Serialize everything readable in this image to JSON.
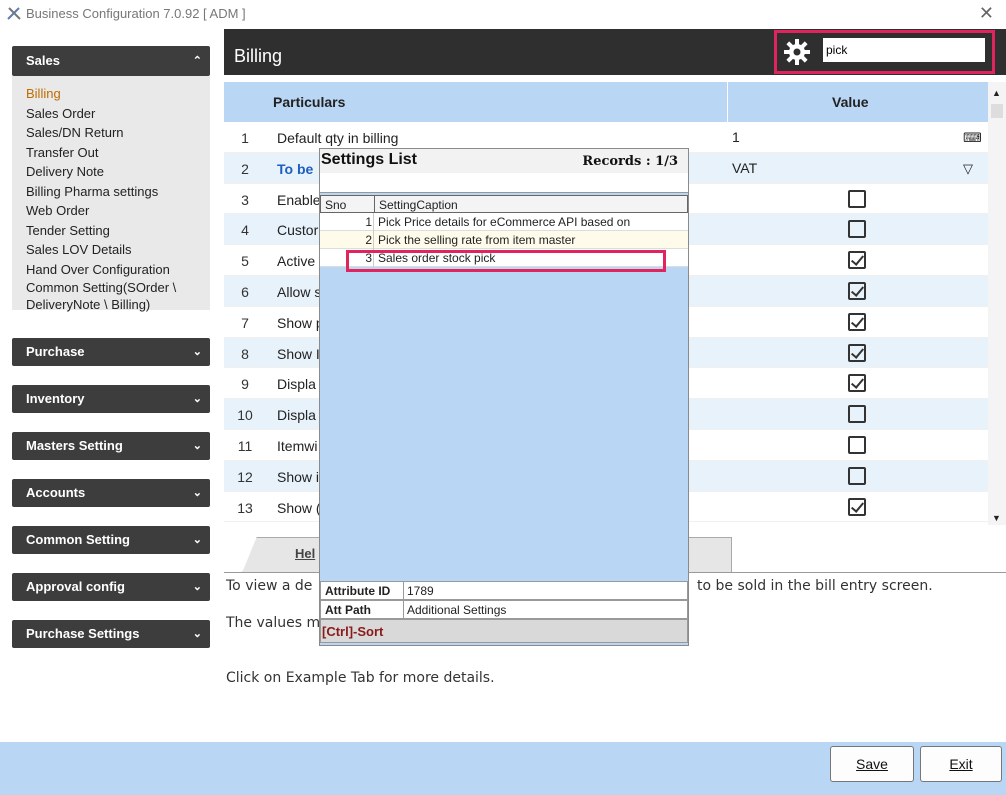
{
  "window": {
    "title": "Business Configuration 7.0.92 [ ADM ]",
    "close_glyph": "✕"
  },
  "sidebar": {
    "sales": {
      "label": "Sales",
      "items": [
        "Billing",
        "Sales Order",
        "Sales/DN Return",
        "Transfer Out",
        "Delivery Note",
        "Billing Pharma settings",
        "Web Order",
        "Tender Setting",
        "Sales LOV Details",
        "Hand Over Configuration",
        "Common Setting(SOrder \\",
        "DeliveryNote \\ Billing)"
      ]
    },
    "groups": [
      "Purchase",
      "Inventory",
      "Masters Setting",
      "Accounts",
      "Common Setting",
      "Approval config",
      "Purchase Settings"
    ]
  },
  "header": {
    "title": "Billing",
    "search_value": "pick"
  },
  "grid": {
    "col_particulars": "Particulars",
    "col_value": "Value",
    "rows": [
      {
        "sno": "1",
        "text": "Default qty in  billing",
        "value": "1"
      },
      {
        "sno": "2",
        "text": "To be",
        "value": "VAT"
      },
      {
        "sno": "3",
        "text": "Enable"
      },
      {
        "sno": "4",
        "text": "Custor"
      },
      {
        "sno": "5",
        "text": "Active"
      },
      {
        "sno": "6",
        "text": "Allow s"
      },
      {
        "sno": "7",
        "text": "Show p"
      },
      {
        "sno": "8",
        "text": "Show I"
      },
      {
        "sno": "9",
        "text": "Displa"
      },
      {
        "sno": "10",
        "text": "Displa"
      },
      {
        "sno": "11",
        "text": "Itemwi"
      },
      {
        "sno": "12",
        "text": "Show i"
      },
      {
        "sno": "13",
        "text": "Show ("
      }
    ],
    "checkboxes": [
      false,
      false,
      true,
      true,
      true,
      true,
      true,
      false,
      false,
      false,
      true
    ]
  },
  "tabs": {
    "help": "Hel"
  },
  "help_text": {
    "line1_left": "To view a de",
    "line1_right": "to be sold  in the bill entry screen.",
    "line2": "The values m",
    "line3": "Click on Example Tab for more details."
  },
  "popup": {
    "title": "Settings List",
    "records": "Records : 1/3",
    "col_sno": "Sno",
    "col_caption": "SettingCaption",
    "rows": [
      {
        "sno": "1",
        "caption": "Pick Price details for eCommerce API based on"
      },
      {
        "sno": "2",
        "caption": "Pick the selling rate from item master"
      },
      {
        "sno": "3",
        "caption": "Sales order stock pick"
      }
    ],
    "attribute_id_label": "Attribute ID",
    "attribute_id_value": "1789",
    "att_path_label": "Att Path",
    "att_path_value": "Additional Settings",
    "sort_hint": "[Ctrl]-Sort"
  },
  "buttons": {
    "save": "Save",
    "exit": "Exit"
  }
}
